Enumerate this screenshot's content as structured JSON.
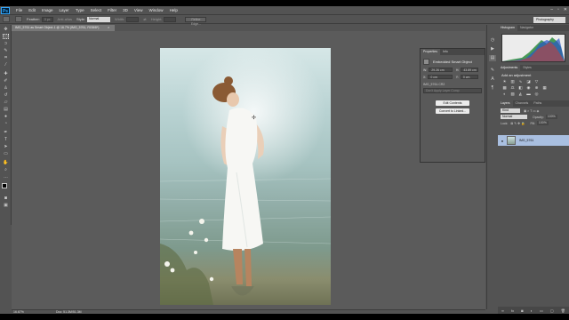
{
  "app": {
    "logo": "Ps",
    "title": "Photoshop"
  },
  "menu": [
    "File",
    "Edit",
    "Image",
    "Layer",
    "Type",
    "Select",
    "Filter",
    "3D",
    "View",
    "Window",
    "Help"
  ],
  "window_controls": [
    "–",
    "▫",
    "✕"
  ],
  "options": {
    "feather_label": "Feather:",
    "feather_value": "0 px",
    "anti_alias": "Anti-alias",
    "style_label": "Style:",
    "style_value": "Normal",
    "width_label": "Width:",
    "height_label": "Height:",
    "refine_edge": "Refine Edge...",
    "workspace": "Photography"
  },
  "document": {
    "tab_title": "IMG_5761 as Smart Object-1 @ 16.7% (IMG_5761, RGB/8*)",
    "close": "×",
    "zoom": "16.67%",
    "doc_info": "Doc: 51.3M/51.3M"
  },
  "properties": {
    "tabs": [
      "Properties",
      "Info"
    ],
    "title": "Embedded Smart Object",
    "w_label": "W:",
    "w_value": "29.26 cm",
    "h_label": "H:",
    "h_value": "43.89 cm",
    "x_label": "X:",
    "x_value": "0 cm",
    "y_label": "Y:",
    "y_value": "0 cm",
    "file": "IMG_5761.CR2",
    "comps_placeholder": "Don't Apply Layer Comp",
    "edit_button": "Edit Contents",
    "convert_button": "Convert to Linked..."
  },
  "histogram": {
    "tabs": [
      "Histogram",
      "Navigator"
    ]
  },
  "adjustments": {
    "tabs": [
      "Adjustments",
      "Styles"
    ],
    "title": "Add an adjustment"
  },
  "layers": {
    "tabs": [
      "Layers",
      "Channels",
      "Paths"
    ],
    "kind": "Kind",
    "blend": "Normal",
    "opacity_label": "Opacity:",
    "opacity_value": "100%",
    "lock_label": "Lock:",
    "fill_label": "Fill:",
    "fill_value": "100%",
    "layer_name": "IMG_5761"
  },
  "colors": {
    "chrome": "#535353",
    "selected_layer": "#a9bfe0",
    "document_bg": "#5b5b5b"
  }
}
